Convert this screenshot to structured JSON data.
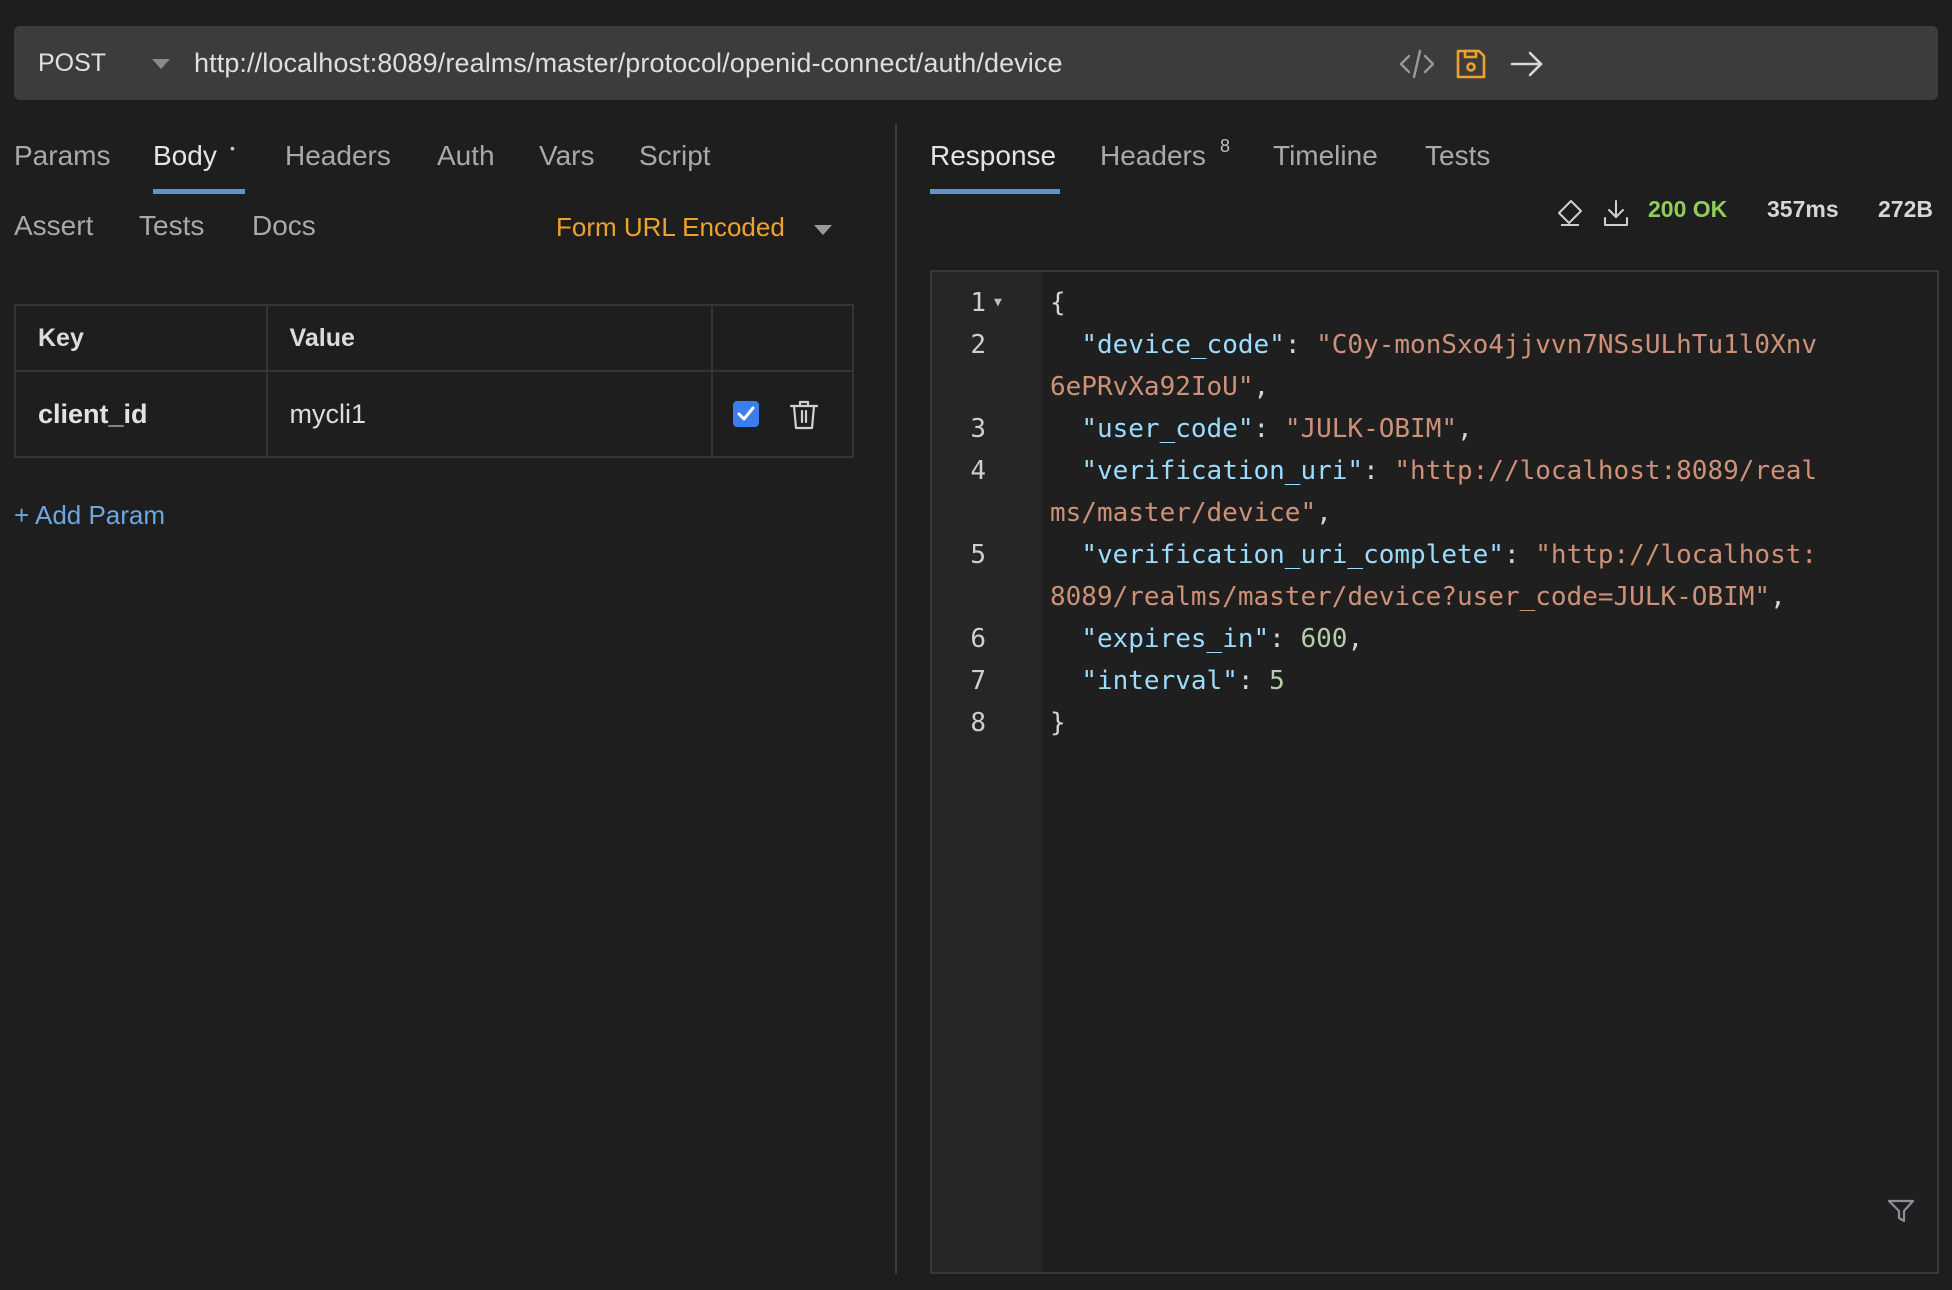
{
  "request": {
    "method": "POST",
    "url": "http://localhost:8089/realms/master/protocol/openid-connect/auth/device",
    "icons": [
      "code-icon",
      "save-icon",
      "send-arrow-icon"
    ]
  },
  "request_tabs": {
    "row1": [
      "Params",
      "Body",
      "Headers",
      "Auth",
      "Vars",
      "Script"
    ],
    "row2": [
      "Assert",
      "Tests",
      "Docs"
    ],
    "active": "Body",
    "modified_dot": "•"
  },
  "body_mode": "Form URL Encoded",
  "params_table": {
    "headers": [
      "Key",
      "Value",
      ""
    ],
    "rows": [
      {
        "key": "client_id",
        "value": "mycli1",
        "enabled": true
      }
    ],
    "add_label": "+ Add Param"
  },
  "response_tabs": {
    "items": [
      "Response",
      "Headers",
      "Timeline",
      "Tests"
    ],
    "active": "Response",
    "headers_count": "8"
  },
  "response_meta": {
    "status": "200 OK",
    "time": "357ms",
    "size": "272B",
    "status_color": "#8fce5b"
  },
  "response_body": {
    "line_numbers": [
      "1",
      "2",
      "",
      "3",
      "4",
      "",
      "5",
      "",
      "6",
      "7",
      "8"
    ],
    "lines": [
      {
        "no": "1",
        "parts": [
          {
            "t": "p",
            "v": "{"
          }
        ]
      },
      {
        "no": "2",
        "parts": [
          {
            "t": "p",
            "v": "  "
          },
          {
            "t": "k",
            "v": "\"device_code\""
          },
          {
            "t": "p",
            "v": ": "
          },
          {
            "t": "s",
            "v": "\"C0y-monSxo4jjvvn7NSsULhTu1l0Xnv"
          }
        ]
      },
      {
        "no": "",
        "parts": [
          {
            "t": "s",
            "v": "6ePRvXa92IoU\""
          },
          {
            "t": "p",
            "v": ","
          }
        ]
      },
      {
        "no": "3",
        "parts": [
          {
            "t": "p",
            "v": "  "
          },
          {
            "t": "k",
            "v": "\"user_code\""
          },
          {
            "t": "p",
            "v": ": "
          },
          {
            "t": "s",
            "v": "\"JULK-OBIM\""
          },
          {
            "t": "p",
            "v": ","
          }
        ]
      },
      {
        "no": "4",
        "parts": [
          {
            "t": "p",
            "v": "  "
          },
          {
            "t": "k",
            "v": "\"verification_uri\""
          },
          {
            "t": "p",
            "v": ": "
          },
          {
            "t": "s",
            "v": "\"http://localhost:8089/real"
          }
        ]
      },
      {
        "no": "",
        "parts": [
          {
            "t": "s",
            "v": "ms/master/device\""
          },
          {
            "t": "p",
            "v": ","
          }
        ]
      },
      {
        "no": "5",
        "parts": [
          {
            "t": "p",
            "v": "  "
          },
          {
            "t": "k",
            "v": "\"verification_uri_complete\""
          },
          {
            "t": "p",
            "v": ": "
          },
          {
            "t": "s",
            "v": "\"http://localhost:"
          }
        ]
      },
      {
        "no": "",
        "parts": [
          {
            "t": "s",
            "v": "8089/realms/master/device?user_code=JULK-OBIM\""
          },
          {
            "t": "p",
            "v": ","
          }
        ]
      },
      {
        "no": "6",
        "parts": [
          {
            "t": "p",
            "v": "  "
          },
          {
            "t": "k",
            "v": "\"expires_in\""
          },
          {
            "t": "p",
            "v": ": "
          },
          {
            "t": "n",
            "v": "600"
          },
          {
            "t": "p",
            "v": ","
          }
        ]
      },
      {
        "no": "7",
        "parts": [
          {
            "t": "p",
            "v": "  "
          },
          {
            "t": "k",
            "v": "\"interval\""
          },
          {
            "t": "p",
            "v": ": "
          },
          {
            "t": "n",
            "v": "5"
          }
        ]
      },
      {
        "no": "8",
        "parts": [
          {
            "t": "p",
            "v": "}"
          }
        ]
      }
    ],
    "fold_marker": "▼"
  },
  "colors": {
    "accent_blue": "#5b95d4",
    "body_mode_orange": "#eea22e",
    "save_icon_orange": "#eea22e",
    "checkbox_blue": "#3b7ded",
    "json_key": "#9cdcfe",
    "json_string": "#ce9178",
    "json_number": "#b5cea8"
  }
}
